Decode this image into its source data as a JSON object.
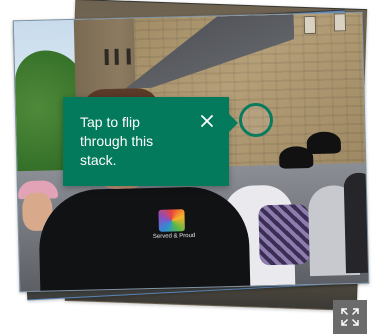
{
  "coach_mark": {
    "text": "Tap to flip through this stack.",
    "close_icon": "close-icon"
  },
  "image_stack": {
    "photos_visible": 3,
    "shirt_logo_text": "Served & Proud"
  },
  "expand": {
    "icon": "expand-icon"
  },
  "colors": {
    "accent": "#047a5c",
    "ring": "#0a7a5f",
    "expand_button_bg": "#6b6b6b"
  }
}
